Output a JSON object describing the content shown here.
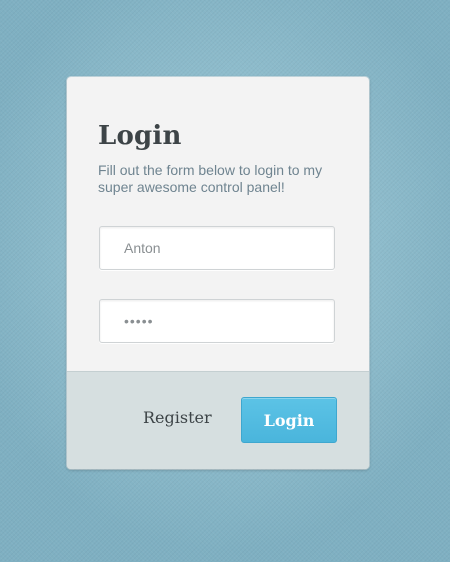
{
  "form": {
    "title": "Login",
    "subtitle": "Fill out the form below to login to my super awesome control panel!",
    "username_value": "Anton",
    "password_value": "•••••"
  },
  "footer": {
    "register_label": "Register",
    "login_label": "Login"
  },
  "colors": {
    "accent": "#52bde3",
    "footer_bg": "#d6dfe0",
    "page_bg": "#8fbccc"
  }
}
